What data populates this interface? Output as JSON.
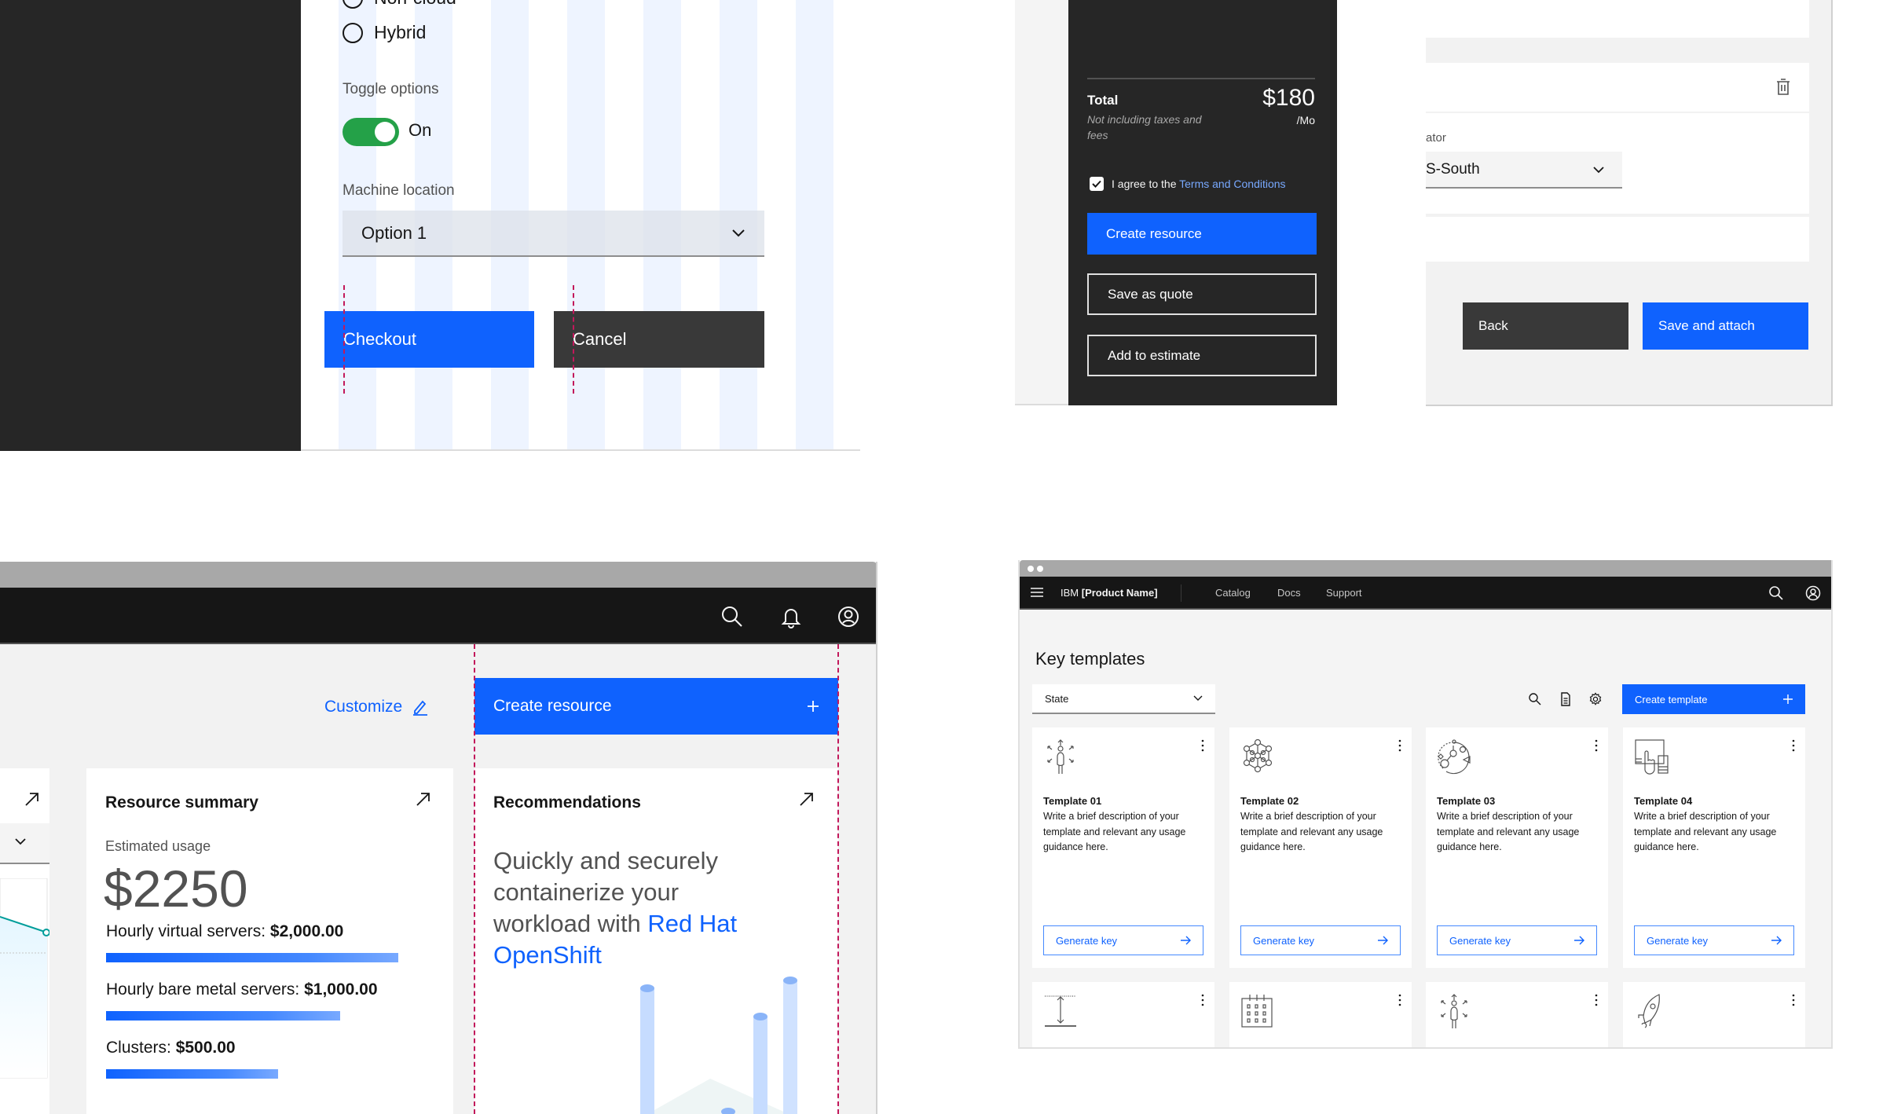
{
  "panel_form": {
    "radio_options": [
      {
        "label": "Non-cloud",
        "selected": false
      },
      {
        "label": "Hybrid",
        "selected": false
      }
    ],
    "toggle_label": "Toggle options",
    "toggle_state": "On",
    "toggle_on": true,
    "machine_location_label": "Machine location",
    "machine_location_value": "Option 1",
    "checkout_label": "Checkout",
    "cancel_label": "Cancel"
  },
  "panel_checkout": {
    "total_label": "Total",
    "total_note": "Not including taxes and fees",
    "price": "$180",
    "period": "/Mo",
    "agree_text": "I agree to the ",
    "agree_link": "Terms and Conditions",
    "agree_checked": true,
    "create_resource": "Create resource",
    "save_as_quote": "Save as quote",
    "add_to_estimate": "Add to estimate"
  },
  "panel_attach": {
    "field_label": "ator",
    "field_value": "S-South",
    "back_label": "Back",
    "save_attach_label": "Save and attach"
  },
  "panel_dashboard": {
    "header_icons": [
      "search-icon",
      "notification-icon",
      "user-avatar-icon"
    ],
    "customize_label": "Customize",
    "create_resource_label": "Create resource",
    "resource_summary": {
      "title": "Resource summary",
      "estimated_label": "Estimated usage",
      "estimated_value": "$2250",
      "items": [
        {
          "label": "Hourly virtual servers: ",
          "value": "$2,000.00",
          "amount": 2000
        },
        {
          "label": "Hourly bare metal servers: ",
          "value": "$1,000.00",
          "amount": 1000
        },
        {
          "label": "Clusters: ",
          "value": "$500.00",
          "amount": 500
        }
      ]
    },
    "recommendations": {
      "title": "Recommendations",
      "text": "Quickly and securely containerize your workload with ",
      "link": "Red Hat OpenShift"
    },
    "colors": {
      "primary": "#0f62fe",
      "chart_line": "#1192e8"
    }
  },
  "panel_templates": {
    "brand_prefix": "IBM ",
    "brand_name": "[Product Name]",
    "nav": [
      "Catalog",
      "Docs",
      "Support"
    ],
    "title": "Key templates",
    "filter_label": "State",
    "create_label": "Create template",
    "cards": [
      {
        "title": "Template 01",
        "description": "Write a brief description of your template and relevant any usage guidance here.",
        "action": "Generate key",
        "icon": "person-directions-icon"
      },
      {
        "title": "Template 02",
        "description": "Write a brief description of your template and relevant any usage guidance here.",
        "action": "Generate key",
        "icon": "network-nodes-icon"
      },
      {
        "title": "Template 03",
        "description": "Write a brief description of your template and relevant any usage guidance here.",
        "action": "Generate key",
        "icon": "cycle-process-icon"
      },
      {
        "title": "Template 04",
        "description": "Write a brief description of your template and relevant any usage guidance here.",
        "action": "Generate key",
        "icon": "touch-devices-icon"
      }
    ],
    "second_row_icons": [
      "height-measure-icon",
      "calendar-grid-icon",
      "person-directions-icon",
      "rocket-icon"
    ]
  }
}
